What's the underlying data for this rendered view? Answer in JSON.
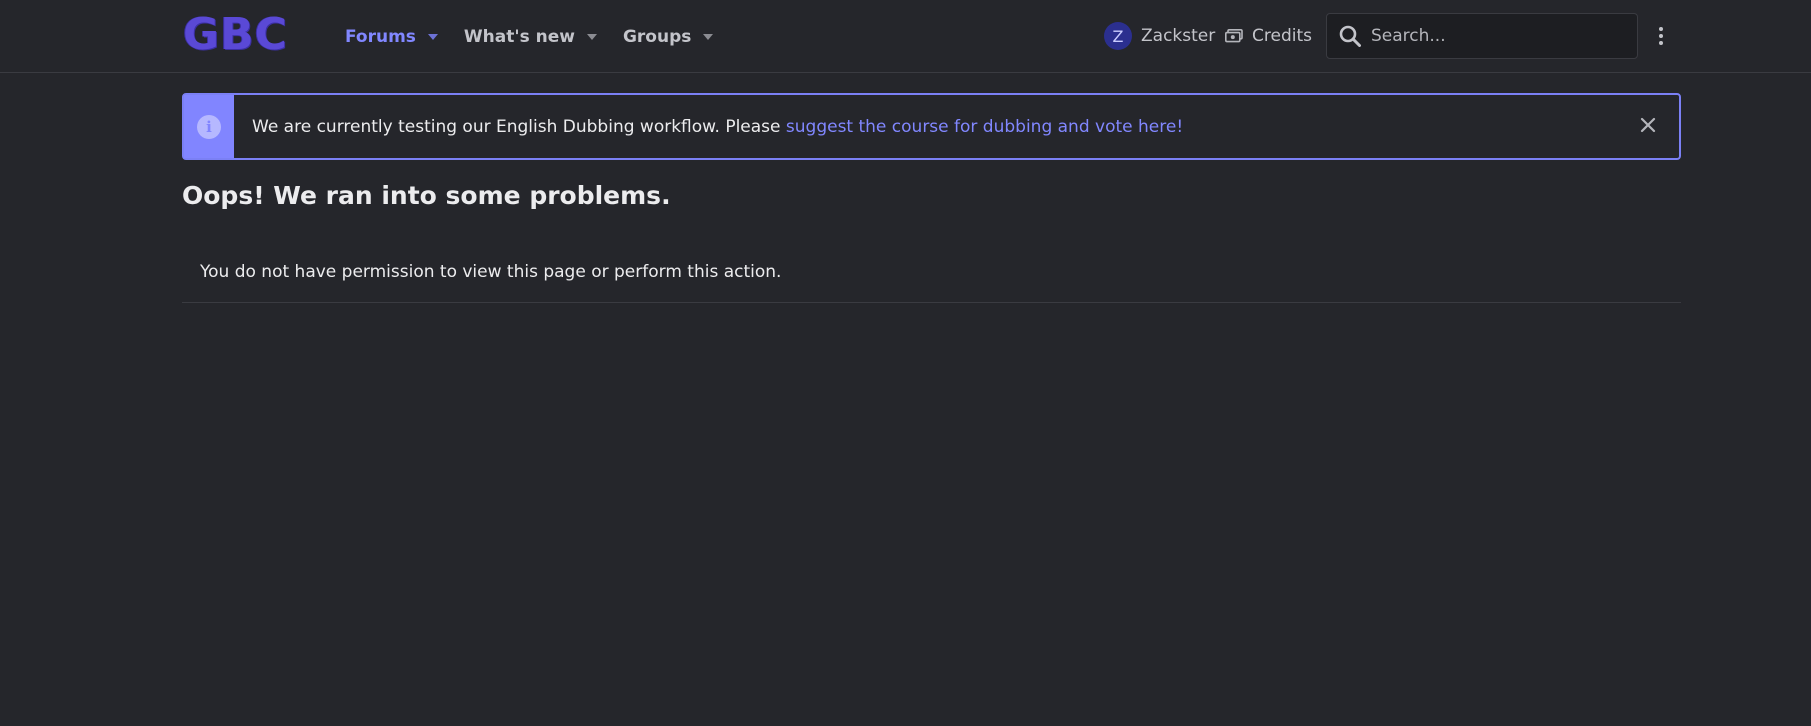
{
  "header": {
    "logo_text": "GBC",
    "nav": [
      {
        "label": "Forums",
        "active": true
      },
      {
        "label": "What's new",
        "active": false
      },
      {
        "label": "Groups",
        "active": false
      }
    ],
    "user": {
      "avatar_letter": "Z",
      "name": "Zackster"
    },
    "credits_label": "Credits",
    "search_placeholder": "Search...",
    "more_icon": "vertical-ellipsis-icon"
  },
  "notice": {
    "icon": "info-icon",
    "text": "We are currently testing our English Dubbing workflow. Please ",
    "link_text": "suggest the course for dubbing and vote here!",
    "close_icon": "close-icon"
  },
  "main": {
    "title": "Oops! We ran into some problems.",
    "message": "You do not have permission to view this page or perform this action."
  },
  "colors": {
    "background": "#25262b",
    "accent": "#8187ff",
    "logo": "#5a49d6"
  }
}
